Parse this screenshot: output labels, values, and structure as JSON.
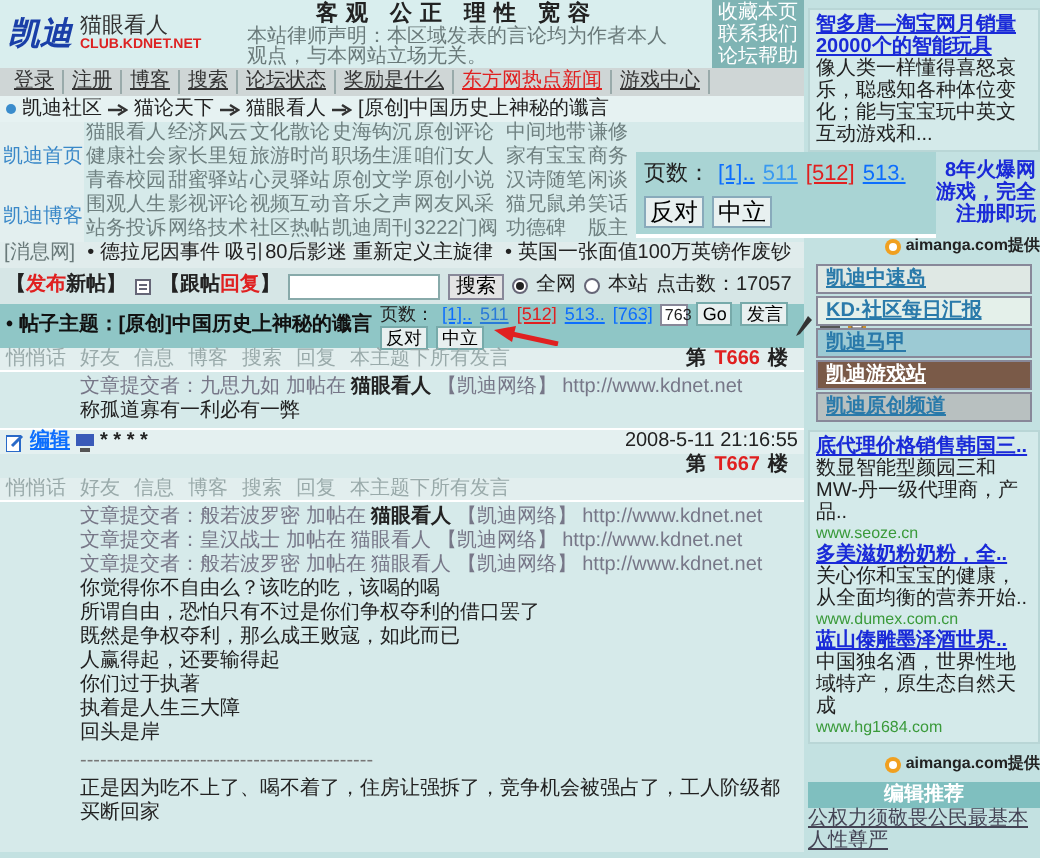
{
  "header": {
    "logo": "凯迪",
    "site_name": "猫眼看人",
    "site_url": "CLUB.KDNET.NET",
    "slogan": "客观 公正 理性 宽容",
    "notice": "本站律师声明：本区域发表的言论均为作者本人观点，与本网站立场无关。",
    "links": [
      "收藏本页",
      "联系我们",
      "论坛帮助"
    ]
  },
  "menu": [
    {
      "label": "登录",
      "highlight": false
    },
    {
      "label": "注册",
      "highlight": false
    },
    {
      "label": "博客",
      "highlight": false
    },
    {
      "label": "搜索",
      "highlight": false
    },
    {
      "label": "论坛状态",
      "highlight": false
    },
    {
      "label": "奖励是什么",
      "highlight": false
    },
    {
      "label": "东方网热点新闻",
      "highlight": true
    },
    {
      "label": "游戏中心",
      "highlight": false
    }
  ],
  "breadcrumb": [
    "凯迪社区",
    "猫论天下",
    "猫眼看人",
    "[原创]中国历史上神秘的谶言"
  ],
  "channels": [
    {
      "label": "凯迪首页",
      "rows": [
        [
          "猫眼看人",
          "经济风云",
          "文化散论",
          "史海钩沉",
          "原创评论",
          "中间地带",
          "谦修"
        ],
        [
          "健康社会",
          "家长里短",
          "旅游时尚",
          "职场生涯",
          "咱们女人",
          "家有宝宝",
          "商务"
        ],
        [
          "青春校园",
          "甜蜜驿站",
          "心灵驿站",
          "原创文学",
          "原创小说",
          "汉诗随笔",
          "闲谈"
        ]
      ]
    },
    {
      "label": "凯迪博客",
      "rows": [
        [
          "围观人生",
          "影视评论",
          "视频互动",
          "音乐之声",
          "网友风采",
          "猫兄鼠弟",
          "笑话"
        ],
        [
          "站务投诉",
          "网络技术",
          "社区热帖",
          "凯迪周刊",
          "3222门阀",
          "功德碑",
          "版主"
        ]
      ]
    }
  ],
  "ticker": {
    "source": "[消息网]",
    "items": [
      "• 德拉尼因事件 吸引80后影迷 重新定义主旋律",
      "• 英国一张面值100万英镑作废钞"
    ]
  },
  "actions": [
    {
      "parts": [
        {
          "text": "【",
          "accent": false
        },
        {
          "text": "发布",
          "accent": true
        },
        {
          "text": "新帖】",
          "accent": false
        }
      ]
    },
    {
      "parts": [
        {
          "text": "【",
          "accent": false
        },
        {
          "text": "跟帖",
          "accent": false
        },
        {
          "text": "回复",
          "accent": true
        },
        {
          "text": "】",
          "accent": false
        }
      ]
    }
  ],
  "search": {
    "button": "搜索",
    "scopes": [
      {
        "label": "全网",
        "selected": true
      },
      {
        "label": "本站",
        "selected": false
      }
    ],
    "hits": "点击数：17057"
  },
  "thread": {
    "title": "• 帖子主题：[原创]中国历史上神秘的谶言",
    "pager_label": "页数：",
    "pages": [
      {
        "text": "[1]..",
        "kind": "plain"
      },
      {
        "text": "511",
        "kind": "link"
      },
      {
        "text": "[512]",
        "kind": "current"
      },
      {
        "text": "513..",
        "kind": "plain"
      },
      {
        "text": "[763]",
        "kind": "plain"
      }
    ],
    "page_input": "763",
    "go": "Go",
    "post": "发言",
    "votes": [
      "反对",
      "中立"
    ]
  },
  "popup": {
    "label": "页数：",
    "pages": [
      {
        "text": "[1]..",
        "kind": "plain"
      },
      {
        "text": "511",
        "kind": "link"
      },
      {
        "text": "[512]",
        "kind": "current"
      },
      {
        "text": "513.",
        "kind": "plain"
      }
    ],
    "votes": [
      "反对",
      "中立"
    ]
  },
  "posts": [
    {
      "floor_prefix": "第",
      "floor": "T666",
      "floor_suffix": "楼",
      "tools": [
        "悄悄话",
        "好友",
        "信息",
        "博客",
        "搜索",
        "回复",
        "本主题下所有发言"
      ],
      "lines": [
        {
          "kind": "byline",
          "text": "文章提交者：九思九如 加帖在 **猫眼看人** 【凯迪网络】 http://www.kdnet.net"
        },
        {
          "kind": "text",
          "text": "称孤道寡有一利必有一弊"
        }
      ],
      "footer": {
        "edit": "编辑",
        "rating": "* * * *",
        "date": "2008-5-11 21:16:55"
      }
    },
    {
      "floor_prefix": "第",
      "floor": "T667",
      "floor_suffix": "楼",
      "tools": [
        "悄悄话",
        "好友",
        "信息",
        "博客",
        "搜索",
        "回复",
        "本主题下所有发言"
      ],
      "lines": [
        {
          "kind": "byline",
          "text": "文章提交者：般若波罗密 加帖在 **猫眼看人** 【凯迪网络】 http://www.kdnet.net"
        },
        {
          "kind": "byline",
          "text": "文章提交者：皇汉战士 加帖在 猫眼看人 【凯迪网络】 http://www.kdnet.net"
        },
        {
          "kind": "byline",
          "text": "文章提交者：般若波罗密 加帖在 猫眼看人 【凯迪网络】 http://www.kdnet.net"
        },
        {
          "kind": "text",
          "text": "你觉得你不自由么？该吃的吃，该喝的喝"
        },
        {
          "kind": "text",
          "text": "所谓自由，恐怕只有不过是你们争权夺利的借口罢了"
        },
        {
          "kind": "text",
          "text": "既然是争权夺利，那么成王败寇，如此而已"
        },
        {
          "kind": "text",
          "text": "人赢得起，还要输得起"
        },
        {
          "kind": "text",
          "text": "你们过于执著"
        },
        {
          "kind": "text",
          "text": "执着是人生三大障"
        },
        {
          "kind": "text",
          "text": "回头是岸"
        },
        {
          "kind": "rule",
          "text": "--------------------------------------------"
        },
        {
          "kind": "text",
          "text": "正是因为吃不上了、喝不着了，住房让强拆了，竞争机会被强占了，工人阶级都买断回家"
        }
      ]
    }
  ],
  "sidebar": [
    {
      "kind": "ad",
      "entries": [
        {
          "title": "智多唐—淘宝网月销量20000个的智能玩具",
          "desc": "像人类一样懂得喜怒哀乐，聪感知各种体位变化；能与宝宝玩中英文互动游戏和..."
        }
      ]
    },
    {
      "kind": "partial",
      "lines": [
        "8年火爆网",
        "游戏，完全",
        "注册即玩"
      ]
    },
    {
      "kind": "provider",
      "text": "aimanga.com提供"
    },
    {
      "kind": "banners",
      "items": [
        {
          "label": "凯迪中速岛",
          "color": "#dfe8e4"
        },
        {
          "label": "KD·社区每日汇报",
          "color": "#e4f0ea"
        },
        {
          "label": "凯迪马甲",
          "color": "#9ccad4"
        },
        {
          "label": "凯迪游戏站",
          "color": "#7a5a48"
        },
        {
          "label": "凯迪原创频道",
          "color": "#b8c0c0"
        }
      ]
    },
    {
      "kind": "ad",
      "entries": [
        {
          "title": "底代理价格销售韩国三..",
          "desc": "数显智能型颜园三和MW-丹一级代理商，产品..",
          "url": "www.seoze.cn"
        },
        {
          "title": "多美滋奶粉奶粉，全..",
          "desc": "关心你和宝宝的健康，从全面均衡的营养开始..",
          "url": "www.dumex.com.cn"
        },
        {
          "title": "蓝山傣雕墨泽酒世界..",
          "desc": "中国独名酒，世界性地域特产，原生态自然天成",
          "url": "www.hg1684.com"
        }
      ]
    },
    {
      "kind": "provider",
      "text": "aimanga.com提供"
    },
    {
      "kind": "recommend",
      "title": "编辑推荐",
      "items": [
        "公权力须敬畏公民最基本人性尊严"
      ]
    }
  ]
}
